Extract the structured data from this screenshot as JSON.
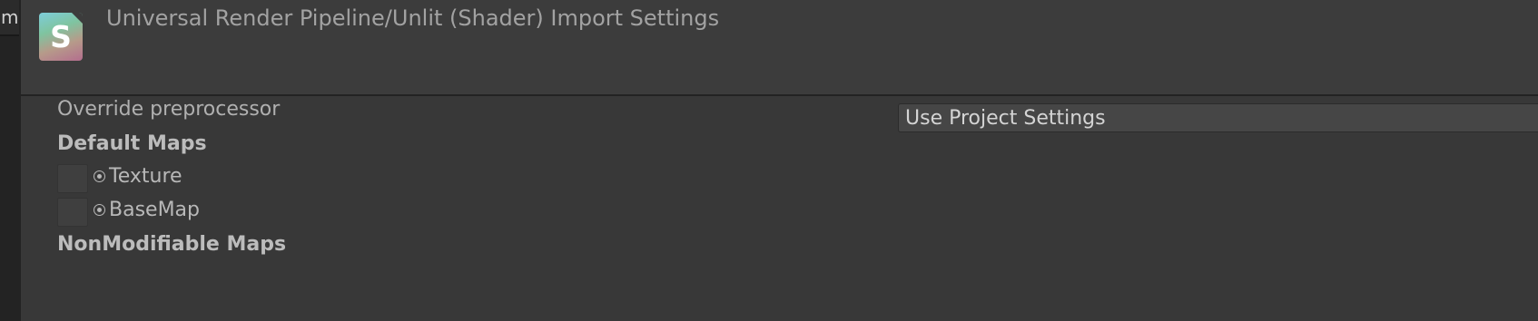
{
  "left_panel": {
    "tab_fragment": "m"
  },
  "header": {
    "icon_glyph": "S",
    "icon_name": "shader-icon",
    "title": "Universal Render Pipeline/Unlit (Shader) Import Settings"
  },
  "settings": {
    "override_preprocessor_label": "Override preprocessor",
    "override_preprocessor_value": "Use Project Settings",
    "default_maps_heading": "Default Maps",
    "default_maps": [
      {
        "name": "Texture"
      },
      {
        "name": "BaseMap"
      }
    ],
    "nonmodifiable_maps_heading": "NonModifiable Maps"
  }
}
